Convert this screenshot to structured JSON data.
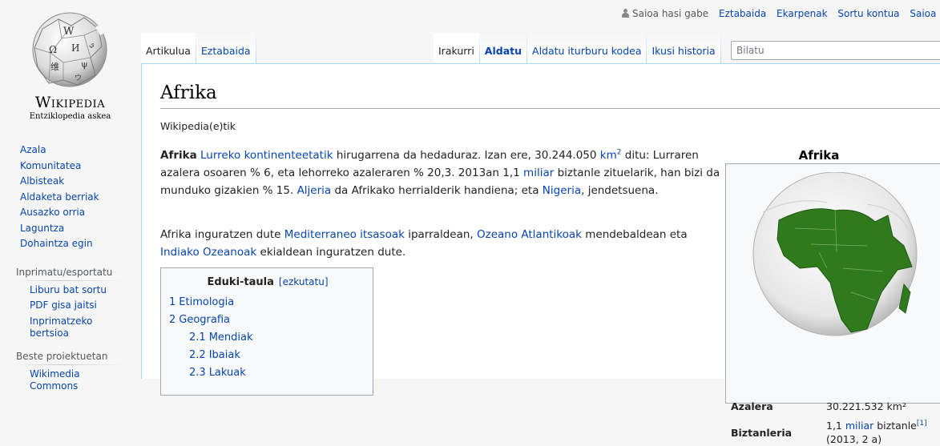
{
  "personal": {
    "anon": "Saioa hasi gabe",
    "links": [
      "Eztabaida",
      "Ekarpenak",
      "Sortu kontua",
      "Saioa hasi"
    ]
  },
  "logo": {
    "wordmark": "Wikipedia",
    "tagline": "Entziklopedia askea",
    "icon": "wikipedia-globe"
  },
  "tabs_left": [
    "Artikulua",
    "Eztabaida"
  ],
  "tabs_right": [
    "Irakurri",
    "Aldatu",
    "Aldatu iturburu kodea",
    "Ikusi historia"
  ],
  "search": {
    "placeholder": "Bilatu"
  },
  "sidebar": {
    "nav": [
      "Azala",
      "Komunitatea",
      "Albisteak",
      "Aldaketa berriak",
      "Ausazko orria",
      "Laguntza",
      "Dohaintza egin"
    ],
    "print_heading": "Inprimatu/esportatu",
    "print_items": [
      "Liburu bat sortu",
      "PDF gisa jaitsi",
      "Inprimatzeko bertsioa"
    ],
    "projects_heading": "Beste proiektuetan",
    "projects_items": [
      "Wikimedia Commons"
    ]
  },
  "article": {
    "title": "Afrika",
    "site_sub": "Wikipedia(e)tik",
    "p1": {
      "bold": "Afrika",
      "link1": "Lurreko kontinenteetatik",
      "t1": " hirugarrena da hedaduraz. Izan ere, 30.244.050 ",
      "link_km": "km",
      "sup": "2",
      "t2": " ditu: Lurraren azalera osoaren % 6, eta lehorreko azaleraren % 20,3. 2013an 1,1 ",
      "link2": "miliar",
      "t3": " biztanle zituelarik, han bizi da munduko gizakien % 15. ",
      "link3": "Aljeria",
      "t4": " da Afrikako herrialderik handiena; eta ",
      "link4": "Nigeria",
      "t5": ", jendetsuena."
    },
    "p2": {
      "t1": "Afrika inguratzen dute ",
      "link1": "Mediterraneo itsasoak",
      "t2": " iparraldean, ",
      "link2": "Ozeano Atlantikoak",
      "t3": " mendebaldean eta ",
      "link3": "Indiako Ozeanoak",
      "t4": " ekialdean inguratzen dute."
    }
  },
  "toc": {
    "title": "Eduki-taula",
    "toggle": "[ezkutatu]",
    "items": [
      {
        "num": "1",
        "label": "Etimologia"
      },
      {
        "num": "2",
        "label": "Geografia"
      },
      {
        "num": "2.1",
        "label": "Mendiak"
      },
      {
        "num": "2.2",
        "label": "Ibaiak"
      },
      {
        "num": "2.3",
        "label": "Lakuak"
      }
    ]
  },
  "infobox": {
    "title": "Afrika",
    "map": "africa-orthographic-globe",
    "rows": [
      {
        "label": "Azalera",
        "value": "30.221.532 km²"
      },
      {
        "label": "Biztanleria",
        "value_link": "miliar",
        "value_pre": "1,1 ",
        "value_post": " biztanle",
        "value_sup": "[1]",
        "value_line2": "(2013, 2 a)"
      }
    ]
  },
  "colors": {
    "link": "#0645ad",
    "content_bg": "#ffffff",
    "chrome_bg": "#f6f6f6",
    "land": "#2f7a1d"
  }
}
